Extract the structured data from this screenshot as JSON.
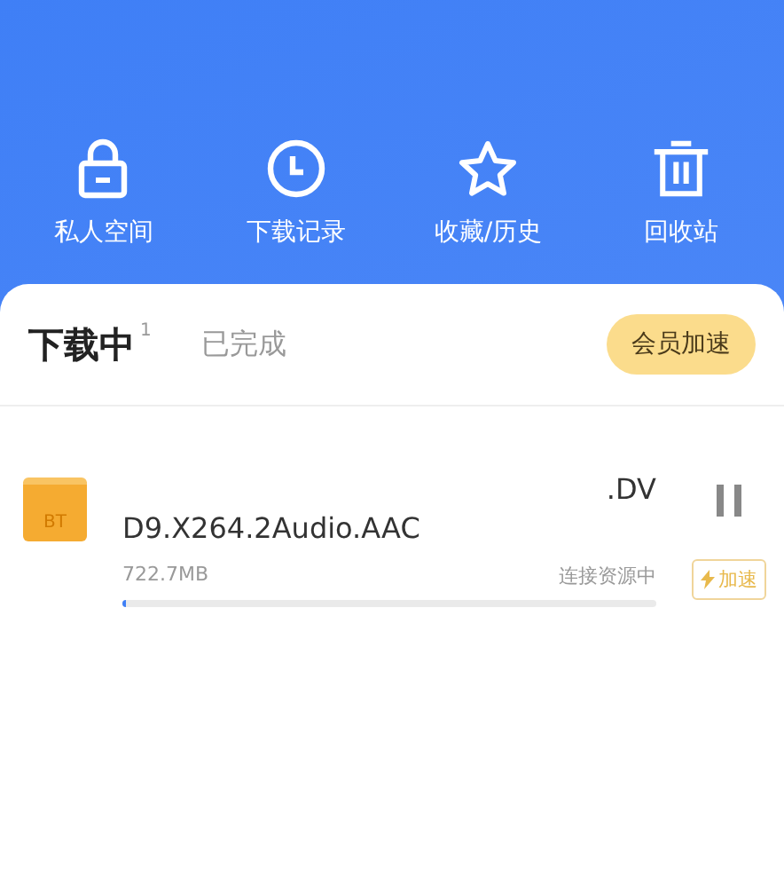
{
  "shortcuts": [
    {
      "kind": "lock",
      "label": "私人空间"
    },
    {
      "kind": "clock",
      "label": "下载记录"
    },
    {
      "kind": "star",
      "label": "收藏/历史"
    },
    {
      "kind": "trash",
      "label": "回收站"
    }
  ],
  "tabs": [
    {
      "label": "下载中",
      "count": "1",
      "selected": true
    },
    {
      "label": "已完成",
      "selected": false
    }
  ],
  "vip_button": "会员加速",
  "downloads": [
    {
      "badge": "BT",
      "name_lines": [
        ".DV",
        "D9.X264.2Audio.AAC"
      ],
      "size": "722.7MB",
      "status": "连接资源中",
      "level": 0.005,
      "speed_button": "加速",
      "paused": false
    }
  ]
}
